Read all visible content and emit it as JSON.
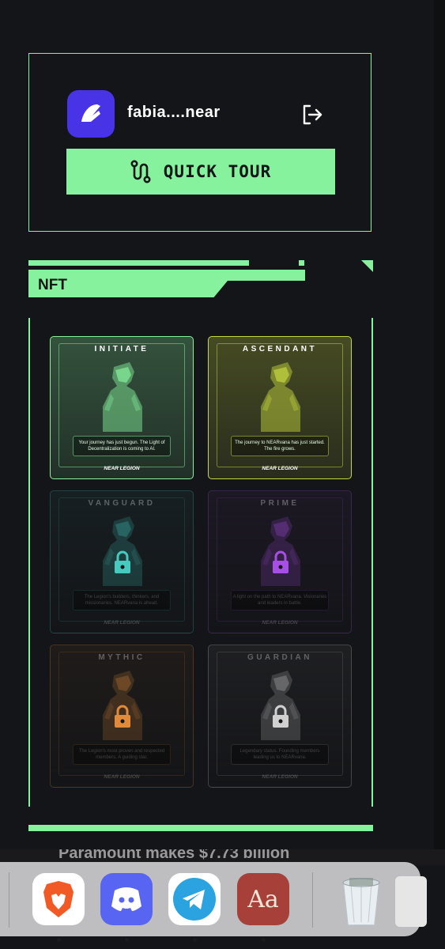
{
  "account": {
    "name": "fabia....near",
    "quick_tour_label": "QUICK TOUR"
  },
  "nft_section": {
    "label": "NFT",
    "cards": [
      {
        "title": "INITIATE",
        "description": "Your journey has just begun. The Light of Decentralization is coming to AI.",
        "footer": "NEAR LEGION",
        "locked": false,
        "color": "#86f29d"
      },
      {
        "title": "ASCENDANT",
        "description": "The journey to NEARvana has just started. The fire grows.",
        "footer": "NEAR LEGION",
        "locked": false,
        "color": "#c7d83f"
      },
      {
        "title": "VANGUARD",
        "description": "The Legion's builders, thinkers, and missionaries. NEARvana is ahead.",
        "footer": "NEAR LEGION",
        "locked": true,
        "color": "#46c9bf"
      },
      {
        "title": "PRIME",
        "description": "A light on the path to NEARvana. Visionaries and leaders in battle.",
        "footer": "NEAR LEGION",
        "locked": true,
        "color": "#a64ee6"
      },
      {
        "title": "MYTHIC",
        "description": "The Legion's most proven and respected members. A guiding star.",
        "footer": "NEAR LEGION",
        "locked": true,
        "color": "#e08a3a"
      },
      {
        "title": "GUARDIAN",
        "description": "Legendary status. Founding members leading us to NEARvana.",
        "footer": "NEAR LEGION",
        "locked": true,
        "color": "#d0d0d0"
      }
    ]
  },
  "background_news": "Paramount makes $7.73 billion",
  "dock": {
    "apps": [
      {
        "name": "Brave",
        "icon": "brave-lion-icon",
        "running": true
      },
      {
        "name": "Discord",
        "icon": "discord-icon",
        "running": true
      },
      {
        "name": "Telegram",
        "icon": "telegram-icon",
        "running": true
      },
      {
        "name": "Dictionary",
        "icon": "dictionary-icon",
        "label": "Aa",
        "running": true
      },
      {
        "name": "Trash",
        "icon": "trash-icon",
        "running": false
      }
    ]
  },
  "colors": {
    "accent": "#86f29d",
    "background": "#141518",
    "wallet_brand": "#4834e6"
  }
}
